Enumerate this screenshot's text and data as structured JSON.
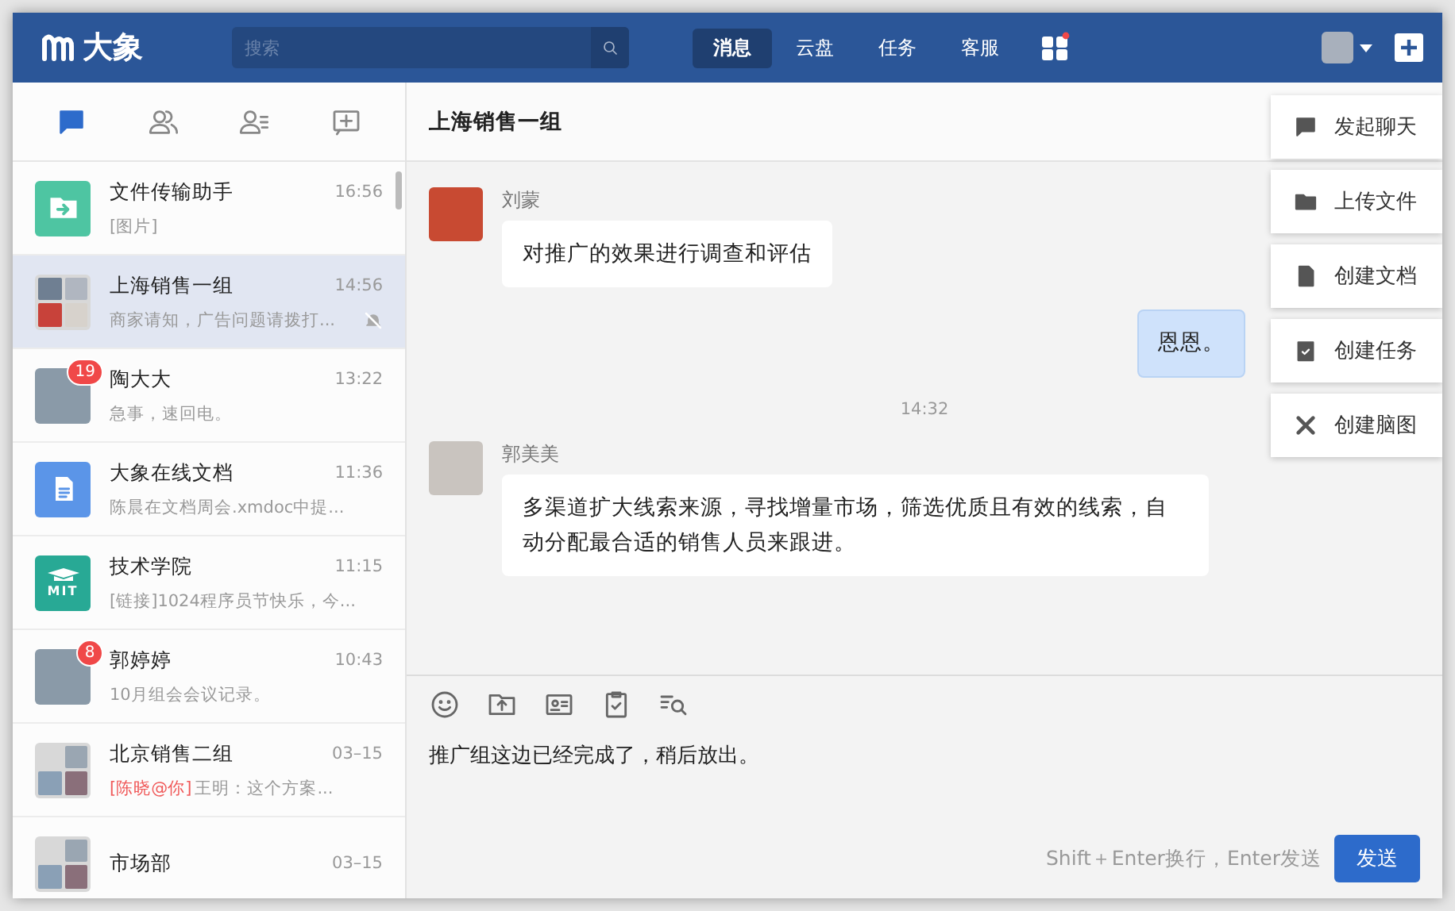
{
  "topbar": {
    "logo_text": "大象",
    "search": {
      "placeholder": "搜索"
    },
    "nav": [
      {
        "label": "消息",
        "selected": true
      },
      {
        "label": "云盘",
        "selected": false
      },
      {
        "label": "任务",
        "selected": false
      },
      {
        "label": "客服",
        "selected": false
      }
    ],
    "apps_dot": true
  },
  "sidebar_tabs": [
    {
      "kind": "chat",
      "selected": true
    },
    {
      "kind": "contacts",
      "selected": false
    },
    {
      "kind": "org",
      "selected": false
    },
    {
      "kind": "new",
      "selected": false
    }
  ],
  "conversations": [
    {
      "kind": "file",
      "name": "文件传输助手",
      "time": "16:56",
      "preview": "[图片]",
      "selected": false,
      "muted": false
    },
    {
      "kind": "group4",
      "name": "上海销售一组",
      "time": "14:56",
      "preview": "商家请知，广告问题请拨打...",
      "selected": true,
      "muted": true
    },
    {
      "kind": "photo",
      "name": "陶大大",
      "time": "13:22",
      "preview": "急事，速回电。",
      "badge": "19",
      "selected": false,
      "muted": false
    },
    {
      "kind": "doc",
      "name": "大象在线文档",
      "time": "11:36",
      "preview": "陈晨在文档周会.xmdoc中提...",
      "selected": false,
      "muted": false
    },
    {
      "kind": "logo",
      "logo_text": "MIT",
      "name": "技术学院",
      "time": "11:15",
      "preview": "[链接]1024程序员节快乐，今...",
      "selected": false,
      "muted": false
    },
    {
      "kind": "photo",
      "name": "郭婷婷",
      "time": "10:43",
      "preview": "10月组会会议记录。",
      "badge": "8",
      "selected": false,
      "muted": false
    },
    {
      "kind": "group3",
      "name": "北京销售二组",
      "time": "03–15",
      "mention": "[陈晓@你]",
      "preview": "王明：这个方案...",
      "selected": false,
      "muted": false
    },
    {
      "kind": "group3",
      "name": "市场部",
      "time": "03–15",
      "selected": false
    }
  ],
  "chat": {
    "title": "上海销售一组",
    "messages": [
      {
        "kind": "incoming",
        "sender": "刘蒙",
        "text": "对推广的效果进行调查和评估"
      },
      {
        "kind": "outgoing",
        "text": "恩恩。"
      },
      {
        "kind": "time",
        "text": "14:32"
      },
      {
        "kind": "incoming",
        "sender": "郭美美",
        "text": "多渠道扩大线索来源，寻找增量市场，筛选优质且有效的线索，自动分配最合适的销售人员来跟进。"
      }
    ],
    "tools": [
      {
        "kind": "emoji"
      },
      {
        "kind": "upload"
      },
      {
        "kind": "card"
      },
      {
        "kind": "task"
      },
      {
        "kind": "search"
      }
    ],
    "input": {
      "value": "推广组这边已经完成了，稍后放出。"
    },
    "hint": "Shift＋Enter换行，Enter发送",
    "send_label": "发送"
  },
  "menu": [
    {
      "kind": "chat",
      "label": "发起聊天"
    },
    {
      "kind": "folder",
      "label": "上传文件"
    },
    {
      "kind": "doc",
      "label": "创建文档"
    },
    {
      "kind": "task",
      "label": "创建任务"
    },
    {
      "kind": "mindmap",
      "label": "创建脑图"
    }
  ]
}
